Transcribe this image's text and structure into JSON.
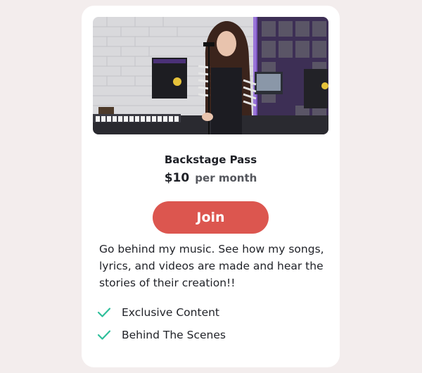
{
  "tier": {
    "name": "Backstage Pass",
    "price": "$10",
    "period": "per month",
    "join_label": "Join",
    "description": "Go behind my music. See how my songs, lyrics, and videos are made and hear the stories of their creation!!",
    "benefits": [
      {
        "label": "Exclusive Content",
        "icon": "check-icon"
      },
      {
        "label": "Behind The Scenes",
        "icon": "check-icon"
      }
    ]
  },
  "colors": {
    "accent": "#dc564f",
    "check": "#2fbf9b",
    "background": "#f3eded"
  }
}
